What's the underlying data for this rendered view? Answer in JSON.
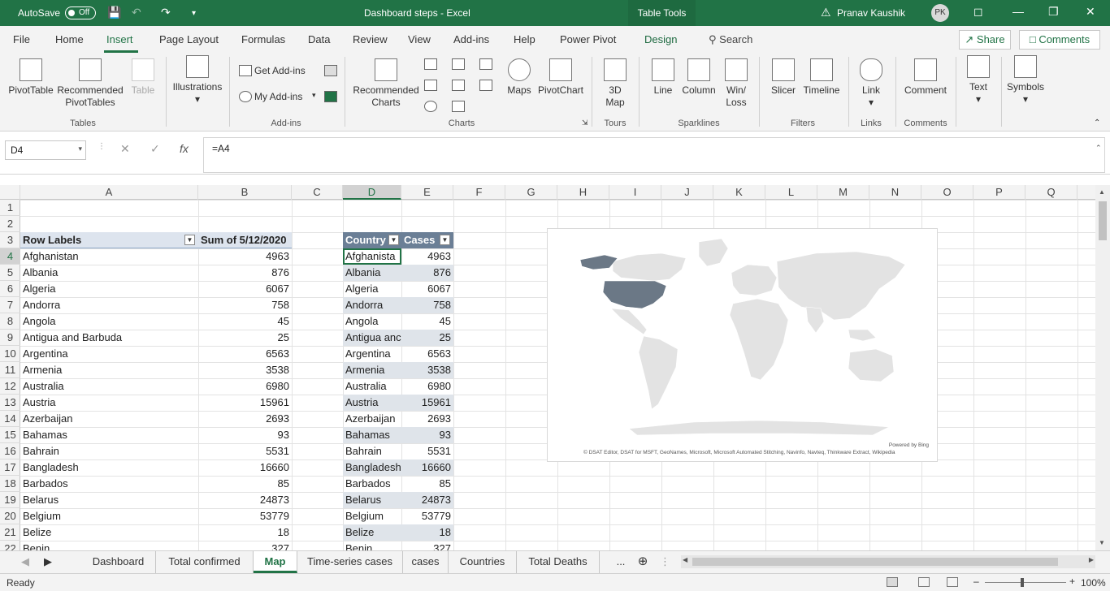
{
  "titlebar": {
    "autosave_label": "AutoSave",
    "autosave_state": "Off",
    "doc_title": "Dashboard steps  -  Excel",
    "context_tab": "Table Tools",
    "user_name": "Pranav Kaushik",
    "user_initials": "PK"
  },
  "menu": {
    "tabs": [
      "File",
      "Home",
      "Insert",
      "Page Layout",
      "Formulas",
      "Data",
      "Review",
      "View",
      "Add-ins",
      "Help",
      "Power Pivot",
      "Design"
    ],
    "active": "Insert",
    "search": "Search",
    "share": "Share",
    "comments": "Comments"
  },
  "ribbon": {
    "groups": {
      "tables": "Tables",
      "addins": "Add-ins",
      "charts": "Charts",
      "tours": "Tours",
      "sparklines": "Sparklines",
      "filters": "Filters",
      "links": "Links",
      "comments": "Comments"
    },
    "buttons": {
      "pivottable": "PivotTable",
      "recommended_pivottables_1": "Recommended",
      "recommended_pivottables_2": "PivotTables",
      "table": "Table",
      "illustrations": "Illustrations",
      "get_addins": "Get Add-ins",
      "my_addins": "My Add-ins",
      "recommended_charts_1": "Recommended",
      "recommended_charts_2": "Charts",
      "maps": "Maps",
      "pivotchart": "PivotChart",
      "map3d_1": "3D",
      "map3d_2": "Map",
      "line": "Line",
      "column": "Column",
      "winloss_1": "Win/",
      "winloss_2": "Loss",
      "slicer": "Slicer",
      "timeline": "Timeline",
      "link": "Link",
      "comment": "Comment",
      "text": "Text",
      "symbols": "Symbols"
    }
  },
  "formula": {
    "namebox": "D4",
    "value": "=A4"
  },
  "columns": [
    "A",
    "B",
    "C",
    "D",
    "E",
    "F",
    "G",
    "H",
    "I",
    "J",
    "K",
    "L",
    "M",
    "N",
    "O",
    "P",
    "Q"
  ],
  "rows": [
    "1",
    "2",
    "3",
    "4",
    "5",
    "6",
    "7",
    "8",
    "9",
    "10",
    "11",
    "12",
    "13",
    "14",
    "15",
    "16",
    "17",
    "18",
    "19",
    "20",
    "21",
    "22"
  ],
  "pivot": {
    "header_label": "Row Labels",
    "header_value": "Sum of 5/12/2020",
    "rows": [
      {
        "label": "Afghanistan",
        "value": "4963"
      },
      {
        "label": "Albania",
        "value": "876"
      },
      {
        "label": "Algeria",
        "value": "6067"
      },
      {
        "label": "Andorra",
        "value": "758"
      },
      {
        "label": "Angola",
        "value": "45"
      },
      {
        "label": "Antigua and Barbuda",
        "value": "25"
      },
      {
        "label": "Argentina",
        "value": "6563"
      },
      {
        "label": "Armenia",
        "value": "3538"
      },
      {
        "label": "Australia",
        "value": "6980"
      },
      {
        "label": "Austria",
        "value": "15961"
      },
      {
        "label": "Azerbaijan",
        "value": "2693"
      },
      {
        "label": "Bahamas",
        "value": "93"
      },
      {
        "label": "Bahrain",
        "value": "5531"
      },
      {
        "label": "Bangladesh",
        "value": "16660"
      },
      {
        "label": "Barbados",
        "value": "85"
      },
      {
        "label": "Belarus",
        "value": "24873"
      },
      {
        "label": "Belgium",
        "value": "53779"
      },
      {
        "label": "Belize",
        "value": "18"
      },
      {
        "label": "Benin",
        "value": "327"
      }
    ]
  },
  "table": {
    "header_country": "Country",
    "header_cases": "Cases",
    "rows": [
      {
        "country": "Afghanista",
        "cases": "4963"
      },
      {
        "country": "Albania",
        "cases": "876"
      },
      {
        "country": "Algeria",
        "cases": "6067"
      },
      {
        "country": "Andorra",
        "cases": "758"
      },
      {
        "country": "Angola",
        "cases": "45"
      },
      {
        "country": "Antigua anc",
        "cases": "25"
      },
      {
        "country": "Argentina",
        "cases": "6563"
      },
      {
        "country": "Armenia",
        "cases": "3538"
      },
      {
        "country": "Australia",
        "cases": "6980"
      },
      {
        "country": "Austria",
        "cases": "15961"
      },
      {
        "country": "Azerbaijan",
        "cases": "2693"
      },
      {
        "country": "Bahamas",
        "cases": "93"
      },
      {
        "country": "Bahrain",
        "cases": "5531"
      },
      {
        "country": "Bangladesh",
        "cases": "16660"
      },
      {
        "country": "Barbados",
        "cases": "85"
      },
      {
        "country": "Belarus",
        "cases": "24873"
      },
      {
        "country": "Belgium",
        "cases": "53779"
      },
      {
        "country": "Belize",
        "cases": "18"
      },
      {
        "country": "Benin",
        "cases": "327"
      }
    ]
  },
  "map": {
    "powered_by": "Powered by Bing",
    "attribution": "© DSAT Editor, DSAT for MSFT, GeoNames, Microsoft, Microsoft Automated Stitching, Navinfo, Navteq, Thinkware Extract, Wikipedia",
    "highlight_color": "#6b7886",
    "land_color": "#e3e3e3"
  },
  "sheets": {
    "tabs": [
      "Dashboard",
      "Total confirmed",
      "Map",
      "Time-series cases",
      "cases",
      "Countries",
      "Total Deaths"
    ],
    "active": "Map",
    "more": "..."
  },
  "status": {
    "ready": "Ready",
    "zoom": "100%"
  },
  "colors": {
    "excel_green": "#217346",
    "table_header": "#6b7f96",
    "table_band": "#dfe4ea"
  }
}
